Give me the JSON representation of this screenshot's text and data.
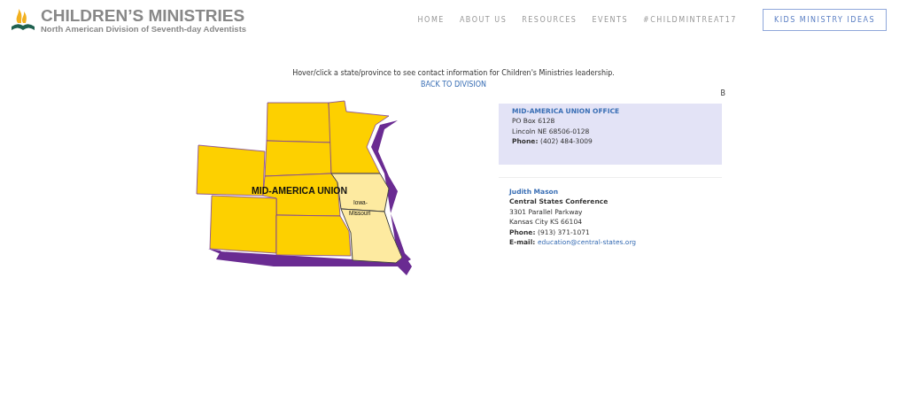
{
  "header": {
    "logo": {
      "title": "CHILDREN’S MINISTRIES",
      "subtitle": "North American Division of Seventh-day Adventists"
    },
    "nav": [
      {
        "label": "HOME",
        "kind": "link"
      },
      {
        "label": "ABOUT US",
        "kind": "link"
      },
      {
        "label": "RESOURCES",
        "kind": "link"
      },
      {
        "label": "EVENTS",
        "kind": "link"
      },
      {
        "label": "#CHILDMINTREAT17",
        "kind": "link"
      },
      {
        "label": "KIDS MINISTRY IDEAS",
        "kind": "button"
      }
    ]
  },
  "intro": "Hover/click a state/province to see contact information for Children's Ministries leadership.",
  "back_link": "BACK TO DIVISION",
  "map": {
    "union_label": "MID-AMERICA UNION",
    "conference_label_1": "Iowa-",
    "conference_label_2": "Missouri"
  },
  "side_marker": "B",
  "office": {
    "title": "MID-AMERICA UNION OFFICE",
    "lines": [
      {
        "text": "PO Box 6128"
      },
      {
        "text": "Lincoln NE 68506-0128"
      },
      {
        "label": "Phone:",
        "text": "(402) 484-3009"
      }
    ]
  },
  "contact": {
    "name": "Judith Mason",
    "organization": "Central States Conference",
    "lines": [
      {
        "text": "3301 Parallel Parkway"
      },
      {
        "text": "Kansas City KS 66104"
      },
      {
        "label": "Phone:",
        "text": "(913) 371-1071"
      },
      {
        "label": "E-mail:",
        "text": "education@central-states.org",
        "kind": "link"
      }
    ]
  }
}
